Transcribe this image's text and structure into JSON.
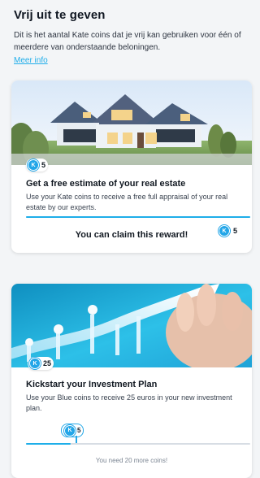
{
  "header": {
    "title": "Vrij uit te geven",
    "description": "Dit is het aantal Kate coins dat je vrij kan gebruiken voor één of meerdere van onderstaande beloningen.",
    "more_info": "Meer info"
  },
  "rewards": [
    {
      "cost": "5",
      "title": "Get a free estimate of your real estate",
      "description": "Use your Kate coins to receive a free full appraisal of your real estate by our experts.",
      "progress": 1.0,
      "progress_value": "5",
      "status_text": "You can claim this reward!"
    },
    {
      "cost": "25",
      "title": "Kickstart your Investment Plan",
      "description": "Use your Blue coins to receive 25 euros in your new investment plan.",
      "progress": 0.2,
      "progress_value": "5",
      "status_text": "You need 20 more coins!"
    }
  ],
  "coin_symbol": "K",
  "colors": {
    "accent": "#20aeea",
    "coin": "#23a6e8"
  },
  "icons": {
    "coin": "k-coin-icon"
  }
}
